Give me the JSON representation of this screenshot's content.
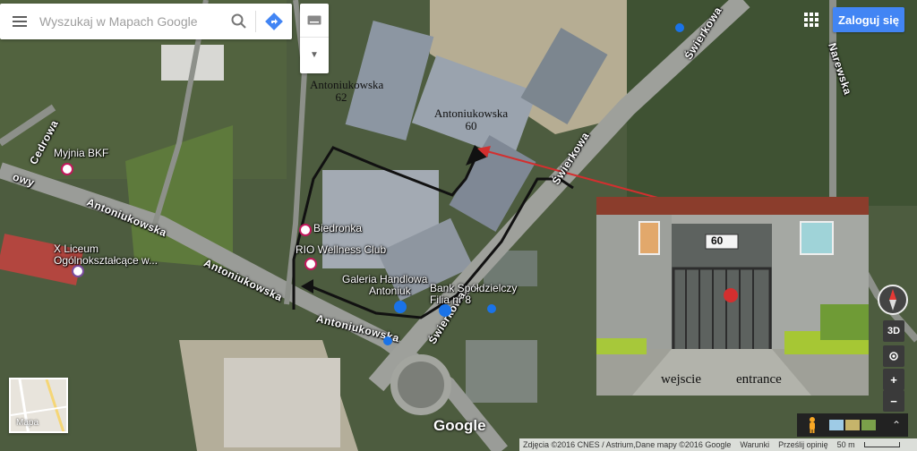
{
  "search": {
    "placeholder": "Wyszukaj w Mapach Google"
  },
  "header": {
    "signin_label": "Zaloguj się"
  },
  "annotations": {
    "building_62_line1": "Antoniukowska",
    "building_62_line2": "62",
    "building_60_line1": "Antoniukowska",
    "building_60_line2": "60"
  },
  "places": {
    "mojnia": "Myjnia BKF",
    "liceum_line1": "X Liceum",
    "liceum_line2": "Ogólnokształcące w...",
    "biedronka": "Biedronka",
    "wellness": "RIO Wellness Club",
    "galeria_line1": "Galeria Handlowa",
    "galeria_line2": "Antoniuk",
    "bank_line1": "Bank Spółdzielczy",
    "bank_line2": "Filia nr 8"
  },
  "streets": {
    "antoniukowska_1": "Antoniukowska",
    "antoniukowska_2": "Antoniukowska",
    "antoniukowska_3": "Antoniukowska",
    "swierkowa_1": "Świerkowa",
    "swierkowa_2": "Świerkowa",
    "swierkowa_3": "Świerkowa",
    "narewska": "Narewska",
    "cedrowa": "Cedrowa",
    "left_edge": "owy"
  },
  "inset": {
    "sign_number": "60",
    "caption_pl": "wejscie",
    "caption_en": "entrance"
  },
  "minimap": {
    "label": "Mapa"
  },
  "controls": {
    "view_3d": "3D",
    "zoom_in": "+",
    "zoom_out": "−"
  },
  "brand": {
    "logo": "Google"
  },
  "attribution": {
    "imagery": "Zdjęcia ©2016 CNES / Astrium,Dane mapy ©2016 Google",
    "terms": "Warunki",
    "feedback": "Prześlij opinię",
    "scale": "50 m"
  },
  "colors": {
    "accent": "#4285f4",
    "route": "#111111",
    "arrow": "#d32f2f",
    "poi": "#c2185b"
  }
}
